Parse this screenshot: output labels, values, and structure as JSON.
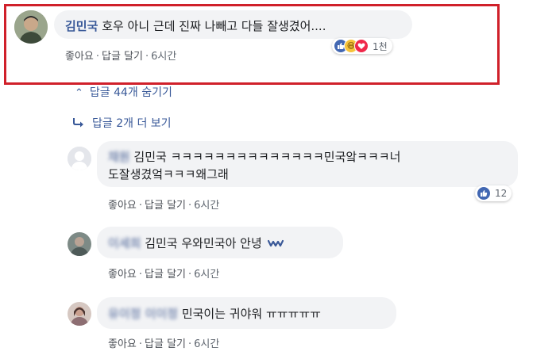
{
  "top_comment": {
    "author": "김민국",
    "text": "호우 아니 근데 진짜 나빼고 다들 잘생겼어....",
    "reaction_count": "1천",
    "actions": {
      "like": "좋아요",
      "reply": "답글 달기",
      "time": "6시간"
    },
    "reaction_icons": [
      "like-icon",
      "haha-icon",
      "love-icon"
    ]
  },
  "thread": {
    "hide_replies": "답글 44개 숨기기",
    "more_replies": "답글 2개 더 보기"
  },
  "replies": [
    {
      "author_blurred": "채원",
      "mention": "김민국",
      "text_line1": "ㅋㅋㅋㅋㅋㅋㅋㅋㅋㅋㅋㅋㅋㅋ민국앜ㅋㅋㅋ너",
      "text_line2": "도잘생겼엌ㅋㅋㅋ왜그래",
      "reaction_count": "12",
      "actions": {
        "like": "좋아요",
        "reply": "답글 달기",
        "time": "6시간"
      }
    },
    {
      "author_blurred": "이세희",
      "mention": "김민국",
      "text": "우와민국아 안녕",
      "emoji": "wave-emoji",
      "actions": {
        "like": "좋아요",
        "reply": "답글 달기",
        "time": "6시간"
      }
    },
    {
      "author_blurred": "유이정 이이정",
      "text": "민국이는 귀야워 ㅠㅠㅠㅠㅠ",
      "actions": {
        "like": "좋아요",
        "reply": "답글 달기",
        "time": "6시간"
      }
    }
  ],
  "colors": {
    "accent": "#385898",
    "highlight_border": "#d0202a",
    "bubble": "#f2f3f5"
  }
}
